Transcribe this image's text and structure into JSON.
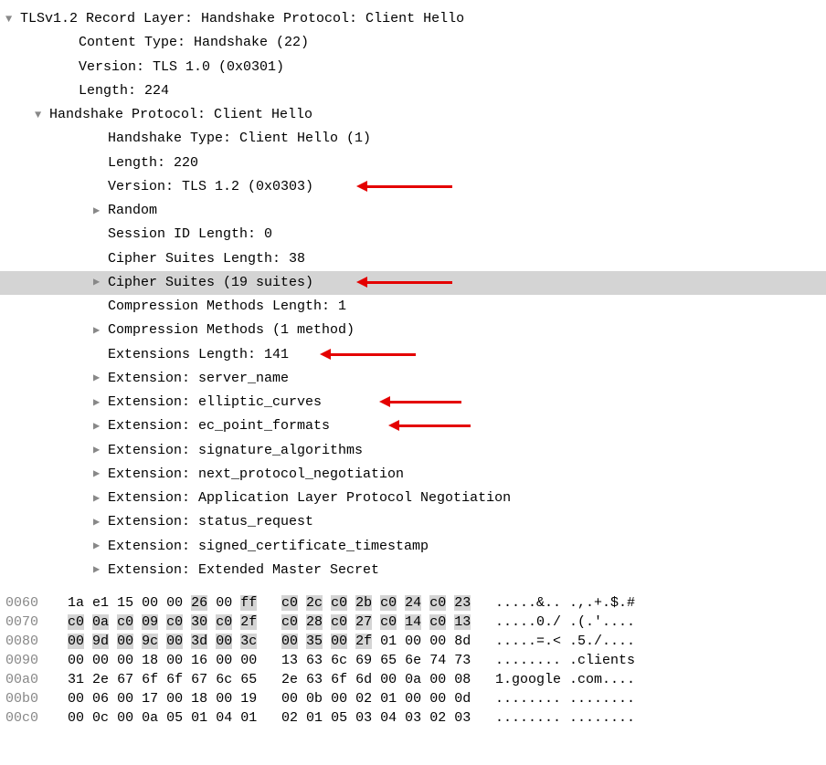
{
  "tree": {
    "r0": "TLSv1.2 Record Layer: Handshake Protocol: Client Hello",
    "r1": "Content Type: Handshake (22)",
    "r2": "Version: TLS 1.0 (0x0301)",
    "r3": "Length: 224",
    "r4": "Handshake Protocol: Client Hello",
    "r5": "Handshake Type: Client Hello (1)",
    "r6": "Length: 220",
    "r7": "Version: TLS 1.2 (0x0303)",
    "r8": "Random",
    "r9": "Session ID Length: 0",
    "r10": "Cipher Suites Length: 38",
    "r11": "Cipher Suites (19 suites)",
    "r12": "Compression Methods Length: 1",
    "r13": "Compression Methods (1 method)",
    "r14": "Extensions Length: 141",
    "r15": "Extension: server_name",
    "r16": "Extension: elliptic_curves",
    "r17": "Extension: ec_point_formats",
    "r18": "Extension: signature_algorithms",
    "r19": "Extension: next_protocol_negotiation",
    "r20": "Extension: Application Layer Protocol Negotiation",
    "r21": "Extension: status_request",
    "r22": "Extension: signed_certificate_timestamp",
    "r23": "Extension: Extended Master Secret"
  },
  "hex": [
    {
      "off": "0060",
      "a": [
        "1a",
        "e1",
        "15",
        "00",
        "00",
        "26",
        "00",
        "ff"
      ],
      "b": [
        "c0",
        "2c",
        "c0",
        "2b",
        "c0",
        "24",
        "c0",
        "23"
      ],
      "ascii": ".....&.. .,.+.$.#",
      "hlA": [
        5,
        7
      ],
      "hlB": [
        0,
        1,
        2,
        3,
        4,
        5,
        6,
        7
      ]
    },
    {
      "off": "0070",
      "a": [
        "c0",
        "0a",
        "c0",
        "09",
        "c0",
        "30",
        "c0",
        "2f"
      ],
      "b": [
        "c0",
        "28",
        "c0",
        "27",
        "c0",
        "14",
        "c0",
        "13"
      ],
      "ascii": ".....0./ .(.'....",
      "hlA": [
        0,
        1,
        2,
        3,
        4,
        5,
        6,
        7
      ],
      "hlB": [
        0,
        1,
        2,
        3,
        4,
        5,
        6,
        7
      ]
    },
    {
      "off": "0080",
      "a": [
        "00",
        "9d",
        "00",
        "9c",
        "00",
        "3d",
        "00",
        "3c"
      ],
      "b": [
        "00",
        "35",
        "00",
        "2f",
        "01",
        "00",
        "00",
        "8d"
      ],
      "ascii": ".....=.< .5./....",
      "hlA": [
        0,
        1,
        2,
        3,
        4,
        5,
        6,
        7
      ],
      "hlB": [
        0,
        1,
        2,
        3
      ]
    },
    {
      "off": "0090",
      "a": [
        "00",
        "00",
        "00",
        "18",
        "00",
        "16",
        "00",
        "00"
      ],
      "b": [
        "13",
        "63",
        "6c",
        "69",
        "65",
        "6e",
        "74",
        "73"
      ],
      "ascii": "........ .clients",
      "hlA": [],
      "hlB": []
    },
    {
      "off": "00a0",
      "a": [
        "31",
        "2e",
        "67",
        "6f",
        "6f",
        "67",
        "6c",
        "65"
      ],
      "b": [
        "2e",
        "63",
        "6f",
        "6d",
        "00",
        "0a",
        "00",
        "08"
      ],
      "ascii": "1.google .com....",
      "hlA": [],
      "hlB": []
    },
    {
      "off": "00b0",
      "a": [
        "00",
        "06",
        "00",
        "17",
        "00",
        "18",
        "00",
        "19"
      ],
      "b": [
        "00",
        "0b",
        "00",
        "02",
        "01",
        "00",
        "00",
        "0d"
      ],
      "ascii": "........ ........",
      "hlA": [],
      "hlB": []
    },
    {
      "off": "00c0",
      "a": [
        "00",
        "0c",
        "00",
        "0a",
        "05",
        "01",
        "04",
        "01"
      ],
      "b": [
        "02",
        "01",
        "05",
        "03",
        "04",
        "03",
        "02",
        "03"
      ],
      "ascii": "........ ........",
      "hlA": [],
      "hlB": []
    }
  ]
}
